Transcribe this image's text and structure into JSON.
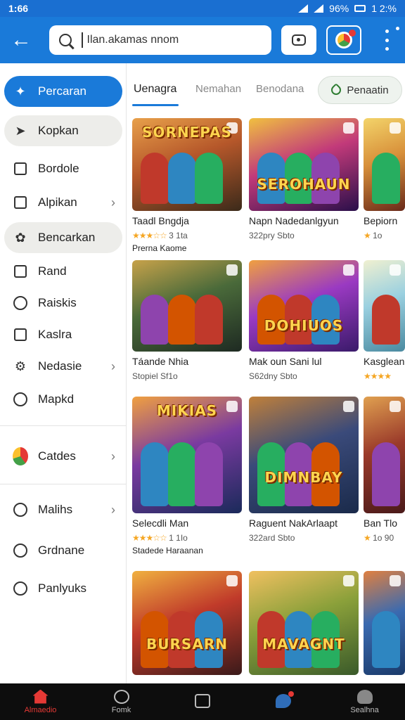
{
  "status": {
    "time": "1:66",
    "battery": "96%",
    "right_time": "1 2:%"
  },
  "search": {
    "query": "Ilan.akamas nnom"
  },
  "sidebar": {
    "items": [
      {
        "label": "Percaran",
        "icon": "puzzle-icon"
      },
      {
        "label": "Kopkan",
        "icon": "rocket-icon"
      },
      {
        "label": "Bordole",
        "icon": "box-icon"
      },
      {
        "label": "Alpikan",
        "icon": "trash-icon"
      },
      {
        "label": "Bencarkan",
        "icon": "leaf-icon"
      },
      {
        "label": "Rand",
        "icon": "checkbox-icon"
      },
      {
        "label": "Raiskis",
        "icon": "shield-icon"
      },
      {
        "label": "Kaslra",
        "icon": "calendar-icon"
      },
      {
        "label": "Nedasie",
        "icon": "gear-icon"
      },
      {
        "label": "Mapkd",
        "icon": "search-icon"
      },
      {
        "label": "Catdes",
        "icon": "colorful-app-icon"
      },
      {
        "label": "Malihs",
        "icon": "location-icon"
      },
      {
        "label": "Grdnane",
        "icon": "controller-icon"
      },
      {
        "label": "Panlyuks",
        "icon": "chat-icon"
      }
    ]
  },
  "tabs": {
    "items": [
      "Uenagra",
      "Nemahan",
      "Benodana"
    ],
    "pill": "Penaatin"
  },
  "games": [
    {
      "logo": "SORNEPAS",
      "title": "Taadl Bngdja",
      "meta": "3 1ta",
      "stars": "★★★☆☆",
      "extra": "Prerna Kaome"
    },
    {
      "logo": "SEROHAUN",
      "title": "Napn Nadedanlgyun",
      "meta": "322pry   Sbto",
      "stars": "",
      "extra": ""
    },
    {
      "logo": "",
      "title": "Bepiorn",
      "meta": "1o",
      "stars": "★",
      "extra": ""
    },
    {
      "logo": "",
      "title": "Táande Nhia",
      "meta": "Stopiel   Sf1o",
      "stars": "",
      "extra": ""
    },
    {
      "logo": "DOHIUOS",
      "title": "Mak oun Sani lul",
      "meta": "S62dny   Sbto",
      "stars": "",
      "extra": ""
    },
    {
      "logo": "",
      "title": "Kasglean",
      "meta": "",
      "stars": "★★★★",
      "extra": ""
    },
    {
      "logo": "MIKIAS",
      "title": "Selecdli Man",
      "meta": "1 1Io",
      "stars": "★★★☆☆",
      "extra": "Stadede Haraanan"
    },
    {
      "logo": "DIMNBAY",
      "title": "Raguent NakArlaapt",
      "meta": "322ard   Sbto",
      "stars": "",
      "extra": ""
    },
    {
      "logo": "",
      "title": "Ban   Tlo",
      "meta": "1o   90",
      "stars": "★",
      "extra": ""
    },
    {
      "logo": "BURSARN",
      "title": "",
      "meta": "",
      "stars": "",
      "extra": ""
    },
    {
      "logo": "MAVAGNT",
      "title": "",
      "meta": "",
      "stars": "",
      "extra": ""
    },
    {
      "logo": "",
      "title": "",
      "meta": "",
      "stars": "",
      "extra": ""
    }
  ],
  "bottomnav": {
    "items": [
      "Almaedio",
      "Fomk",
      "",
      "",
      "Sealhna"
    ]
  }
}
